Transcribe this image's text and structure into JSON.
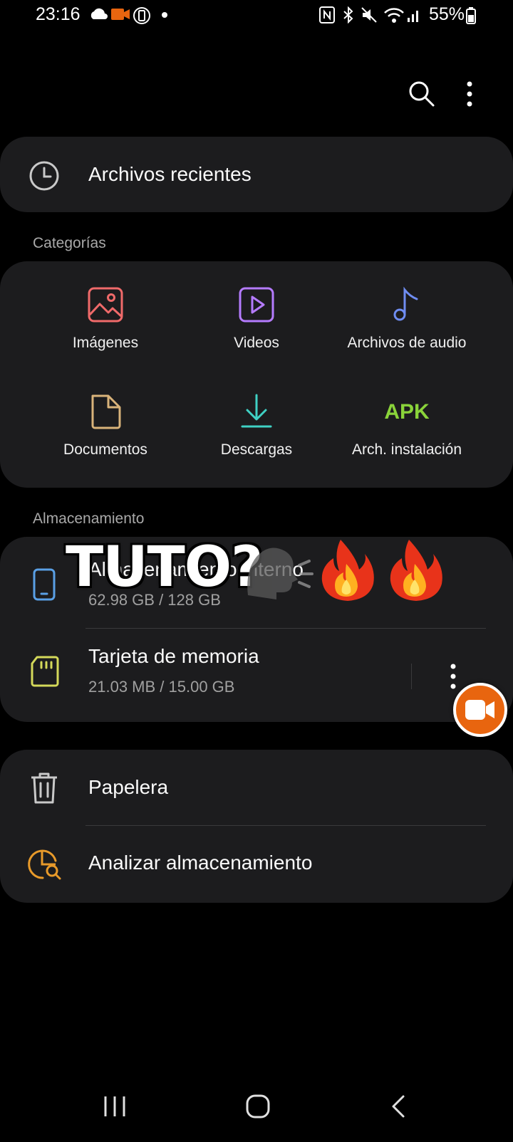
{
  "status_bar": {
    "time": "23:16",
    "battery": "55%"
  },
  "header": {
    "search_icon": "search-icon",
    "more_icon": "more-vert-icon"
  },
  "recent": {
    "label": "Archivos recientes",
    "icon": "clock-icon"
  },
  "categories": {
    "title": "Categorías",
    "items": [
      {
        "label": "Imágenes",
        "icon": "image-icon",
        "color": "#f06a6a"
      },
      {
        "label": "Videos",
        "icon": "video-icon",
        "color": "#b57bff"
      },
      {
        "label": "Archivos de audio",
        "icon": "music-note-icon",
        "color": "#6f8df2"
      },
      {
        "label": "Documentos",
        "icon": "document-icon",
        "color": "#d9b37a"
      },
      {
        "label": "Descargas",
        "icon": "download-icon",
        "color": "#3fd1c4"
      },
      {
        "label": "Arch. instalación",
        "icon": "apk-icon",
        "icon_text": "APK",
        "color": "#8ad33a"
      }
    ]
  },
  "storage": {
    "title": "Almacenamiento",
    "items": [
      {
        "label": "Almacenamiento interno",
        "usage": "62.98 GB / 128 GB",
        "icon": "phone-icon",
        "color": "#5aa0e6"
      },
      {
        "label": "Tarjeta de memoria",
        "usage": "21.03 MB / 15.00 GB",
        "icon": "sd-card-icon",
        "color": "#d4d95a"
      }
    ]
  },
  "tools": {
    "items": [
      {
        "label": "Papelera",
        "icon": "trash-icon"
      },
      {
        "label": "Analizar almacenamiento",
        "icon": "storage-analysis-icon",
        "color": "#e89a2a"
      }
    ]
  },
  "overlay": {
    "text": "TUTO?",
    "emoji": "🗣️🔥🔥"
  },
  "nav": {
    "recents_icon": "recents-icon",
    "home_icon": "home-icon",
    "back_icon": "back-icon"
  }
}
